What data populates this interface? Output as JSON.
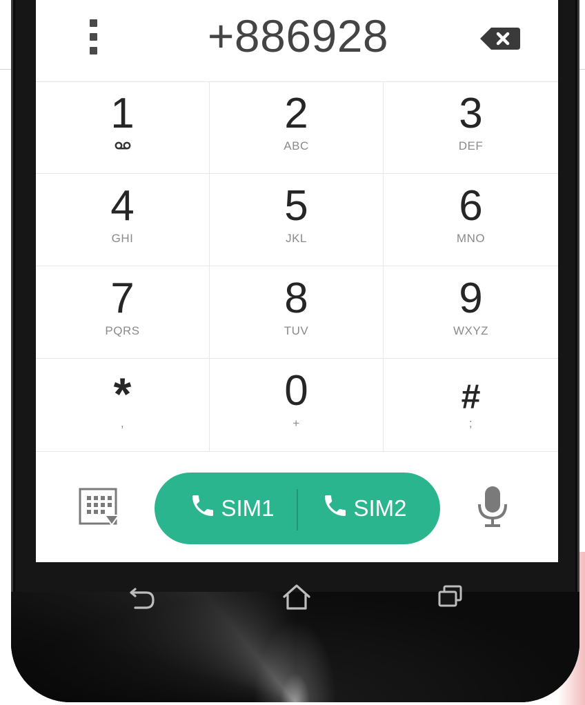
{
  "dialer": {
    "number": "+886928"
  },
  "keypad": [
    {
      "digit": "1",
      "letters": "",
      "sub_icon": "voicemail-icon"
    },
    {
      "digit": "2",
      "letters": "ABC"
    },
    {
      "digit": "3",
      "letters": "DEF"
    },
    {
      "digit": "4",
      "letters": "GHI"
    },
    {
      "digit": "5",
      "letters": "JKL"
    },
    {
      "digit": "6",
      "letters": "MNO"
    },
    {
      "digit": "7",
      "letters": "PQRS"
    },
    {
      "digit": "8",
      "letters": "TUV"
    },
    {
      "digit": "9",
      "letters": "WXYZ"
    },
    {
      "digit": "*",
      "letters": ","
    },
    {
      "digit": "0",
      "letters": "+"
    },
    {
      "digit": "#",
      "letters": ";"
    }
  ],
  "actions": {
    "sim1_label": "SIM1",
    "sim2_label": "SIM2"
  },
  "icons": {
    "menu": "more-vertical-icon",
    "backspace": "backspace-icon",
    "dialpad": "dialpad-toggle-icon",
    "phone": "phone-icon",
    "mic": "microphone-icon",
    "back": "back-icon",
    "home": "home-icon",
    "recents": "recent-apps-icon"
  },
  "colors": {
    "call_green": "#2bb58f",
    "phone_body": "#161616"
  }
}
